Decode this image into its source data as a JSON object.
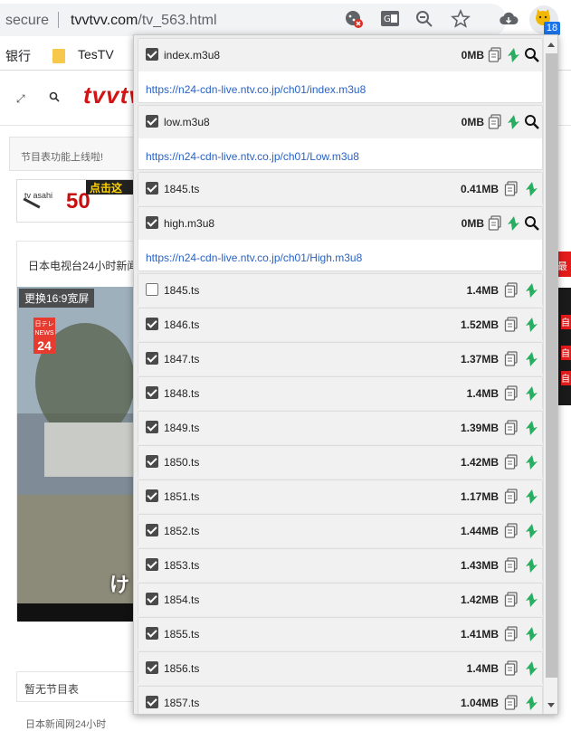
{
  "browser": {
    "secure_label": "secure",
    "host": "tvvtvv.com",
    "path": "/tv_563.html",
    "extension_badge": "18"
  },
  "bookmarks": [
    {
      "label": "银行"
    },
    {
      "label": "TesTV"
    }
  ],
  "page": {
    "logo": "tvvtv",
    "notice": "节目表功能上线啦!",
    "ad_channel": "tv asahi",
    "ad_number": "50",
    "ad_tag": "点击这",
    "panel_title": "日本电视台24小时新闻",
    "video_tag": "更换16:9宽屏",
    "video_logo_top": "日テレ",
    "video_logo_mid": "NEWS",
    "video_logo_num": "24",
    "video_subtitle": "け",
    "right_tab": "最",
    "right_red_label": "自",
    "no_program": "暂无节目表",
    "bottom_text": "日本新闻网24小时"
  },
  "popup": {
    "entries": [
      {
        "name": "index.m3u8",
        "size": "0MB",
        "checked": true,
        "url": "https://n24-cdn-live.ntv.co.jp/ch01/index.m3u8"
      },
      {
        "name": "low.m3u8",
        "size": "0MB",
        "checked": true,
        "url": "https://n24-cdn-live.ntv.co.jp/ch01/Low.m3u8"
      },
      {
        "name": "1845.ts",
        "size": "0.41MB",
        "checked": true
      },
      {
        "name": "high.m3u8",
        "size": "0MB",
        "checked": true,
        "url": "https://n24-cdn-live.ntv.co.jp/ch01/High.m3u8"
      },
      {
        "name": "1845.ts",
        "size": "1.4MB",
        "checked": false
      },
      {
        "name": "1846.ts",
        "size": "1.52MB",
        "checked": true
      },
      {
        "name": "1847.ts",
        "size": "1.37MB",
        "checked": true
      },
      {
        "name": "1848.ts",
        "size": "1.4MB",
        "checked": true
      },
      {
        "name": "1849.ts",
        "size": "1.39MB",
        "checked": true
      },
      {
        "name": "1850.ts",
        "size": "1.42MB",
        "checked": true
      },
      {
        "name": "1851.ts",
        "size": "1.17MB",
        "checked": true
      },
      {
        "name": "1852.ts",
        "size": "1.44MB",
        "checked": true
      },
      {
        "name": "1853.ts",
        "size": "1.43MB",
        "checked": true
      },
      {
        "name": "1854.ts",
        "size": "1.42MB",
        "checked": true
      },
      {
        "name": "1855.ts",
        "size": "1.41MB",
        "checked": true
      },
      {
        "name": "1856.ts",
        "size": "1.4MB",
        "checked": true
      },
      {
        "name": "1857.ts",
        "size": "1.04MB",
        "checked": true
      }
    ]
  },
  "colors": {
    "accent_green": "#27ae60",
    "link_blue": "#2962c4",
    "logo_red": "#d21414"
  }
}
